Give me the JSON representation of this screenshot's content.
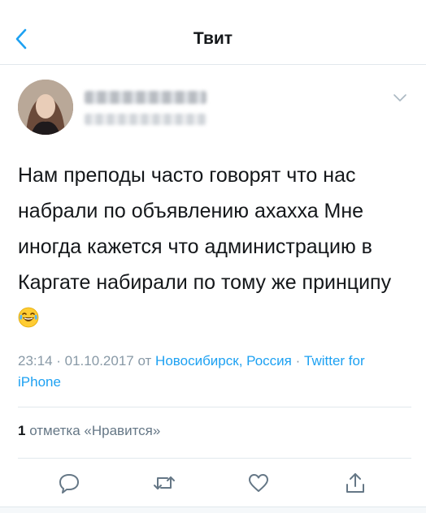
{
  "header": {
    "title": "Твит"
  },
  "tweet": {
    "text": "Нам преподы часто говорят что нас набрали по объявлению ахахха Мне иногда кажется что администрацию в Каргате набирали по тому же принципу",
    "emoji": "face-with-tears-of-joy"
  },
  "meta": {
    "time": "23:14 · 01.10.2017 от ",
    "location": "Новосибирск, Россия",
    "separator": " · ",
    "source": "Twitter for iPhone"
  },
  "likes": {
    "count": "1",
    "label": " отметка «Нравится»"
  },
  "icons": {
    "back": "chevron-left-icon",
    "more": "chevron-down-icon",
    "reply": "reply-icon",
    "retweet": "retweet-icon",
    "like": "heart-icon",
    "share": "share-icon"
  },
  "colors": {
    "accent": "#1da1f2",
    "muted": "#8899a6"
  }
}
